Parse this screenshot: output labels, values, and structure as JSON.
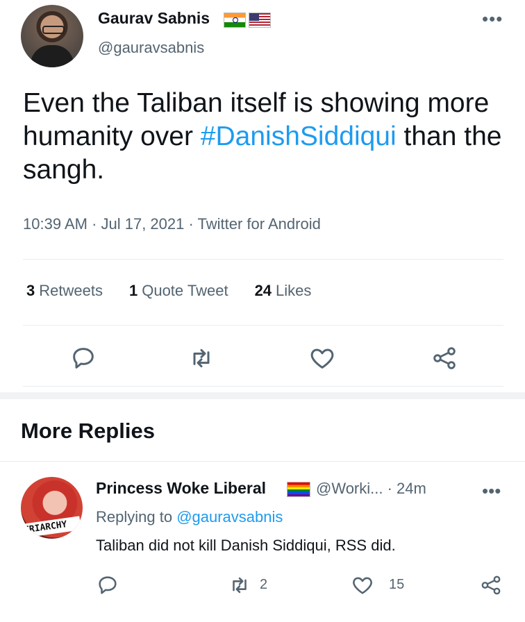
{
  "tweet": {
    "author_name": "Gaurav Sabnis",
    "author_handle": "@gauravsabnis",
    "text_prefix": "Even the Taliban itself is showing more humanity over ",
    "hashtag": "#DanishSiddiqui",
    "text_suffix": " than the sangh.",
    "meta": "10:39 AM · Jul 17, 2021 · Twitter for Android",
    "more_icon": "•••",
    "stats": {
      "retweets_count": "3",
      "retweets_label": "Retweets",
      "quotes_count": "1",
      "quotes_label": "Quote Tweet",
      "likes_count": "24",
      "likes_label": "Likes"
    },
    "flags": [
      "india-flag-icon",
      "us-flag-icon"
    ]
  },
  "section": {
    "more_replies_label": "More Replies"
  },
  "reply": {
    "author_name": "Princess Woke Liberal",
    "author_handle_time": "@Worki... · 24m",
    "replying_prefix": "Replying to ",
    "replying_handle": "@gauravsabnis",
    "text": "Taliban did not kill Danish Siddiqui, RSS did.",
    "retweet_count": "2",
    "like_count": "15",
    "avatar_badge": "TRIARCHY",
    "more_icon": "•••"
  },
  "colors": {
    "accent": "#1d9bf0",
    "secondary_text": "#536471",
    "primary_text": "#0f1419"
  }
}
